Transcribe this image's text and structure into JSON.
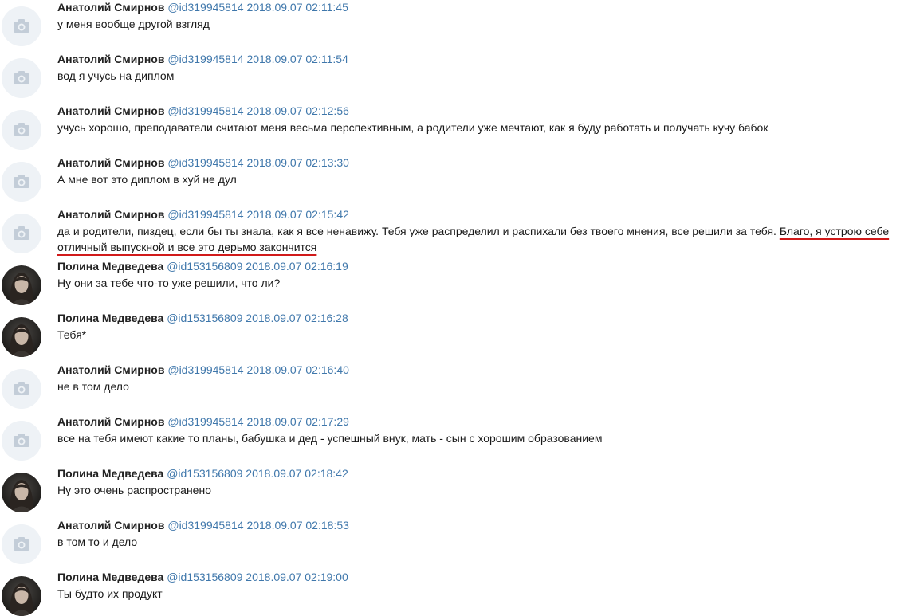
{
  "messages": [
    {
      "author": "Анатолий Смирнов",
      "handle": "@id319945814",
      "timestamp": "2018.09.07 02:11:45",
      "avatar": "camera-placeholder",
      "text": "у меня вообще другой взгляд",
      "highlight": ""
    },
    {
      "author": "Анатолий Смирнов",
      "handle": "@id319945814",
      "timestamp": "2018.09.07 02:11:54",
      "avatar": "camera-placeholder",
      "text": "вод я учусь на диплом",
      "highlight": ""
    },
    {
      "author": "Анатолий Смирнов",
      "handle": "@id319945814",
      "timestamp": "2018.09.07 02:12:56",
      "avatar": "camera-placeholder",
      "text": "учусь хорошо, преподаватели считают меня весьма перспективным, а родители уже мечтают, как я буду работать и получать кучу бабок",
      "highlight": ""
    },
    {
      "author": "Анатолий Смирнов",
      "handle": "@id319945814",
      "timestamp": "2018.09.07 02:13:30",
      "avatar": "camera-placeholder",
      "text": "А мне вот это диплом в хуй не дул",
      "highlight": ""
    },
    {
      "author": "Анатолий Смирнов",
      "handle": "@id319945814",
      "timestamp": "2018.09.07 02:15:42",
      "avatar": "camera-placeholder",
      "text": "да и родители, пиздец, если бы ты знала, как я все ненавижу. Тебя уже распределил и распихали без твоего мнения, все решили за тебя. ",
      "highlight": "Благо, я устрою себе отличный выпускной и все это дерьмо закончится"
    },
    {
      "author": "Полина Медведева",
      "handle": "@id153156809",
      "timestamp": "2018.09.07 02:16:19",
      "avatar": "photo",
      "text": "Ну они за тебе что-то уже решили, что ли?",
      "highlight": ""
    },
    {
      "author": "Полина Медведева",
      "handle": "@id153156809",
      "timestamp": "2018.09.07 02:16:28",
      "avatar": "photo",
      "text": "Тебя*",
      "highlight": ""
    },
    {
      "author": "Анатолий Смирнов",
      "handle": "@id319945814",
      "timestamp": "2018.09.07 02:16:40",
      "avatar": "camera-placeholder",
      "text": "не в том дело",
      "highlight": ""
    },
    {
      "author": "Анатолий Смирнов",
      "handle": "@id319945814",
      "timestamp": "2018.09.07 02:17:29",
      "avatar": "camera-placeholder",
      "text": "все на тебя имеют какие то планы, бабушка и дед - успешный внук, мать - сын с хорошим образованием",
      "highlight": ""
    },
    {
      "author": "Полина Медведева",
      "handle": "@id153156809",
      "timestamp": "2018.09.07 02:18:42",
      "avatar": "photo",
      "text": "Ну это очень распространено",
      "highlight": ""
    },
    {
      "author": "Анатолий Смирнов",
      "handle": "@id319945814",
      "timestamp": "2018.09.07 02:18:53",
      "avatar": "camera-placeholder",
      "text": "в том то и дело",
      "highlight": ""
    },
    {
      "author": "Полина Медведева",
      "handle": "@id153156809",
      "timestamp": "2018.09.07 02:19:00",
      "avatar": "photo",
      "text": "Ты будто их продукт",
      "highlight": ""
    }
  ],
  "colors": {
    "link": "#3f77ab",
    "underline": "#d11a1a",
    "placeholder_bg": "#eef2f6",
    "placeholder_icon": "#c3cdd8"
  }
}
